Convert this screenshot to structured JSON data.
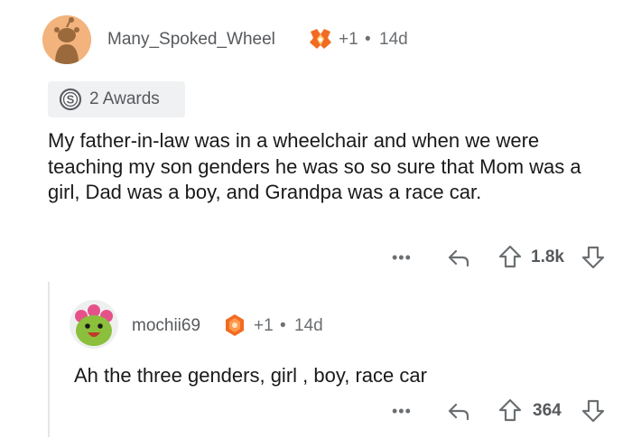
{
  "comment": {
    "username": "Many_Spoked_Wheel",
    "award_count": "+1",
    "separator": "•",
    "age": "14d",
    "awards_label": "2 Awards",
    "body": "My father-in-law was in a wheelchair and when we were teaching my son genders he was so so sure that Mom was a girl, Dad was a boy, and Grandpa was a race car.",
    "more": "•••",
    "score": "1.8k"
  },
  "reply": {
    "username": "mochii69",
    "award_count": "+1",
    "separator": "•",
    "age": "14d",
    "body": "Ah the three genders, girl , boy, race car",
    "more": "•••",
    "score": "364"
  },
  "colors": {
    "avatar1_bg": "#f2b37d",
    "avatar2_bg": "#eef0f0",
    "award_orange": "#f26b22",
    "thread_line": "#e4e6e8",
    "muted_text": "#6b6f72"
  }
}
